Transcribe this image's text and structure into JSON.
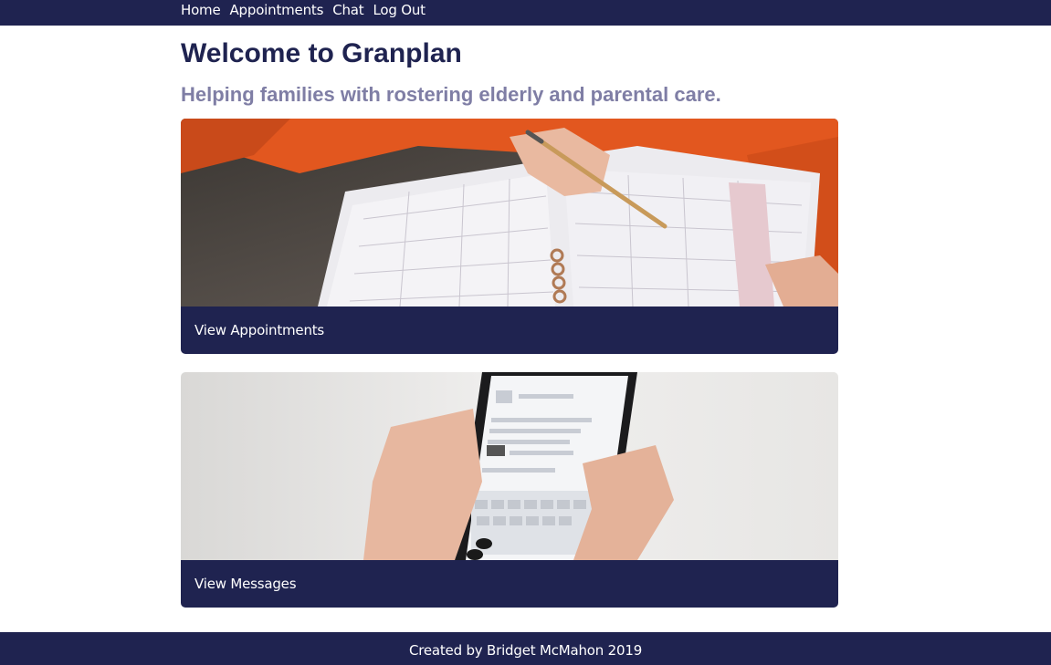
{
  "nav": {
    "items": [
      {
        "label": "Home"
      },
      {
        "label": "Appointments"
      },
      {
        "label": "Chat"
      },
      {
        "label": "Log Out"
      }
    ]
  },
  "main": {
    "title": "Welcome to Granplan",
    "subtitle": "Helping families with rostering elderly and parental care.",
    "cards": [
      {
        "label": "View Appointments",
        "image_icon": "planner-photo"
      },
      {
        "label": "View Messages",
        "image_icon": "smartphone-photo"
      }
    ]
  },
  "footer": {
    "text": "Created by Bridget McMahon 2019"
  },
  "colors": {
    "navy": "#1f2350",
    "subtitle": "#7f7ea5",
    "background": "#ffffff"
  }
}
